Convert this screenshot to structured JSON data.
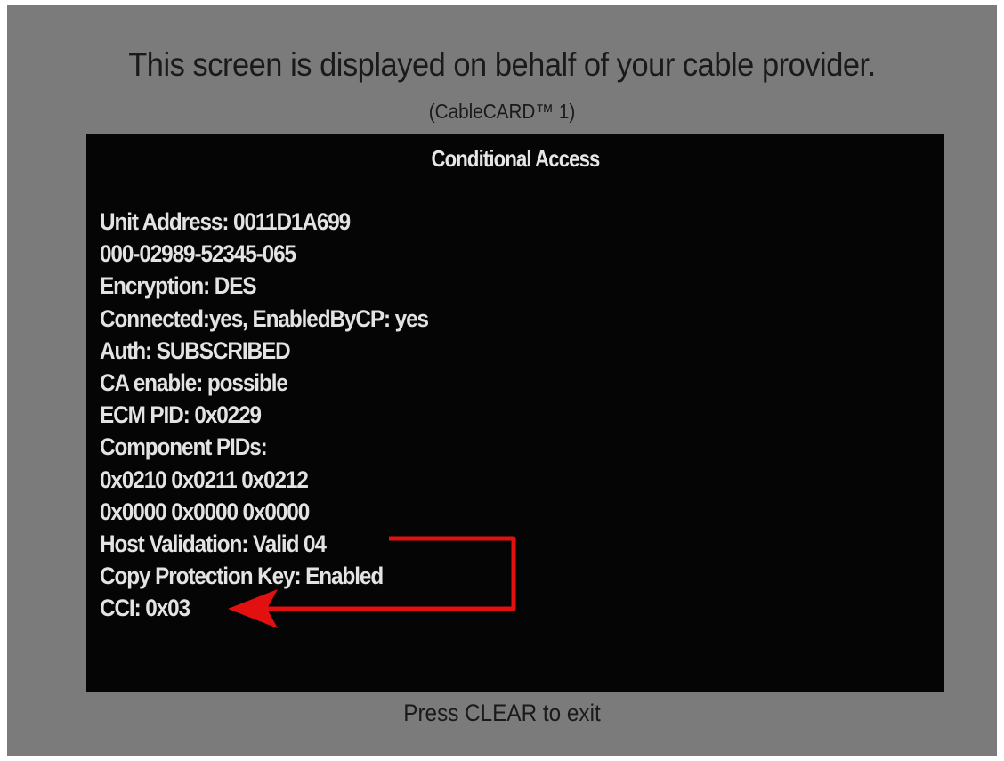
{
  "header": {
    "title": "This screen is displayed on behalf of your cable provider.",
    "subtitle": "(CableCARD™ 1)"
  },
  "panel": {
    "title": "Conditional Access",
    "lines": [
      "Unit Address: 0011D1A699",
      "000-02989-52345-065",
      "Encryption: DES",
      "Connected:yes, EnabledByCP: yes",
      "Auth: SUBSCRIBED",
      "CA enable: possible",
      "ECM PID: 0x0229",
      "Component PIDs:",
      "0x0210 0x0211 0x0212",
      "0x0000 0x0000 0x0000",
      "Host Validation: Valid 04",
      "Copy Protection Key: Enabled",
      "CCI: 0x03"
    ]
  },
  "annotation": {
    "arrow_color": "#e31010"
  },
  "footer": {
    "hint": "Press CLEAR to exit"
  },
  "colors": {
    "screen_background": "#7b7b7b",
    "panel_background": "#050505",
    "panel_text": "#e3e3e3",
    "header_text": "#1a1a1a"
  }
}
